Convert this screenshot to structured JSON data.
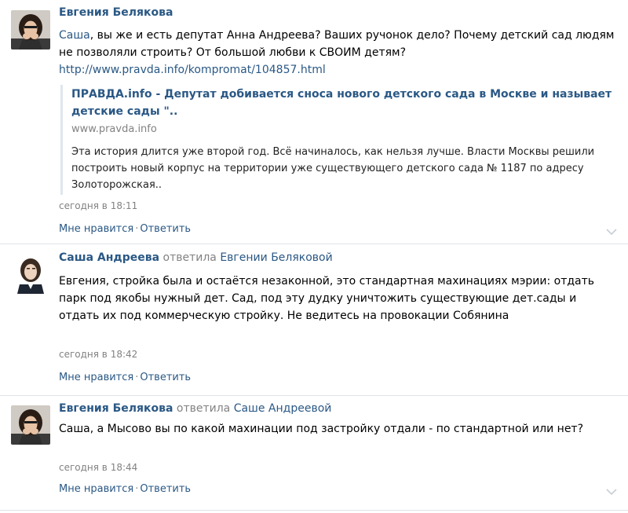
{
  "comments": [
    {
      "author": "Евгения Белякова",
      "text_before_mention": "",
      "mention": "Саша",
      "text": ", вы же и есть депутат Анна Андреева? Ваших ручонок дело? Почему детский сад людям не позволяли строить? От большой любви к СВОИМ детям?",
      "link": "http://www.pravda.info/kompromat/104857.html",
      "preview": {
        "title": "ПРАВДА.info - Депутат добивается сноса нового детского сада в Москве и называет детские сады \"..",
        "domain": "www.pravda.info",
        "description": "Эта история длится уже второй год. Всё начиналось, как нельзя лучше. Власти Москвы решили построить новый корпус на территории уже существующего детского сада № 1187 по адресу Золоторожская.."
      },
      "date": "сегодня в 18:11",
      "like_label": "Мне нравится",
      "reply_label": "Ответить",
      "separator": "·"
    },
    {
      "author": "Саша Андреева",
      "replied_label": "ответила",
      "reply_to": "Евгении Беляковой",
      "text": "Евгения, стройка была и остаётся незаконной, это стандартная махинациях мэрии: отдать парк под якобы нужный дет. Сад, под эту дудку уничтожить существующие дет.сады и отдать их под коммерческую стройку. Не ведитесь на провокации Собянина",
      "date": "сегодня в 18:42",
      "like_label": "Мне нравится",
      "reply_label": "Ответить",
      "separator": "·"
    },
    {
      "author": "Евгения Белякова",
      "replied_label": "ответила",
      "reply_to": "Саше Андреевой",
      "text": "Саша, а Мысово вы по какой махинации под застройку отдали - по стандартной или нет?",
      "date": "сегодня в 18:44",
      "like_label": "Мне нравится",
      "reply_label": "Ответить",
      "separator": "·"
    }
  ],
  "icons": {
    "avatar_1": "avatar-woman-dark-hair",
    "avatar_2": "avatar-woman-portrait",
    "expand": "chevron-down-icon"
  },
  "colors": {
    "link": "#2a5885",
    "meta": "#828282",
    "separator": "#dfe3e8"
  }
}
